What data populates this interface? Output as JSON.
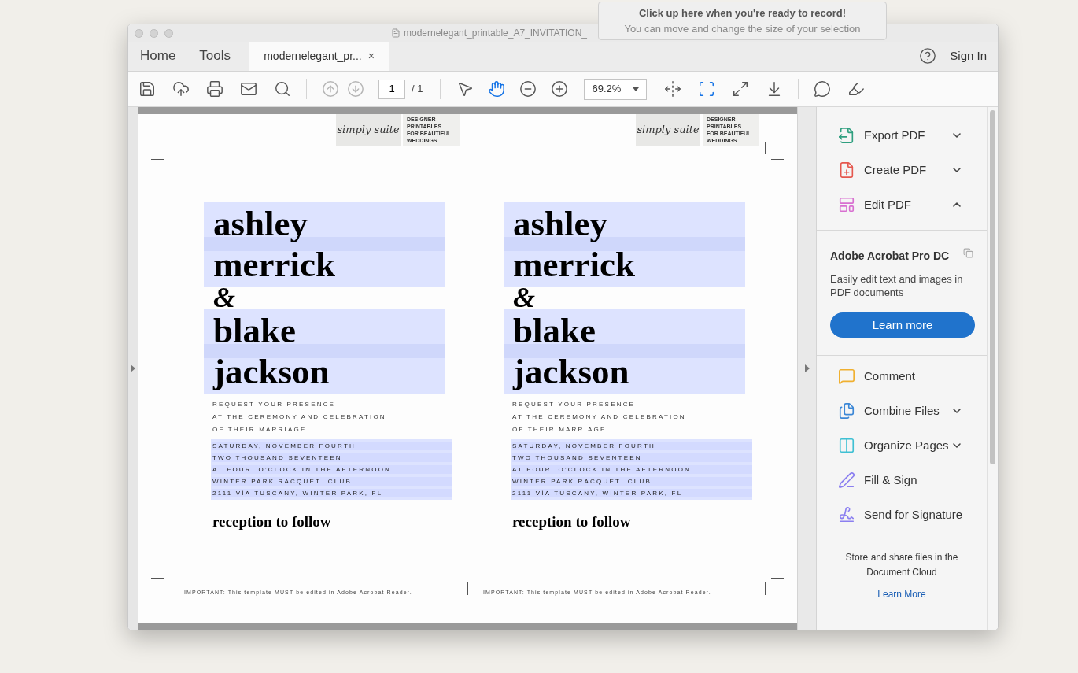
{
  "recorder_tip": {
    "title": "Click up here when you're ready to record!",
    "subtitle": "You can move and change the size of your selection"
  },
  "window": {
    "title": "modernelegant_printable_A7_INVITATION_"
  },
  "tabs": [
    {
      "label": "Home",
      "selected": false
    },
    {
      "label": "Tools",
      "selected": false
    },
    {
      "label": "modernelegant_pr...",
      "selected": true,
      "close": "×"
    }
  ],
  "sign_in": "Sign In",
  "toolbar": {
    "page_number": "1",
    "page_total": "/ 1",
    "zoom": "69.2%",
    "page_nav": [
      {
        "kind": "previous",
        "disabled": true
      },
      {
        "kind": "next",
        "disabled": true
      }
    ],
    "tools": [
      {
        "kind": "select",
        "selected": false
      },
      {
        "kind": "hand",
        "selected": true
      }
    ],
    "view_modes": [
      {
        "kind": "fit_page",
        "selected": false
      },
      {
        "kind": "fit_width",
        "selected": true
      },
      {
        "kind": "full_screen",
        "selected": false
      },
      {
        "kind": "read_mode",
        "selected": false
      }
    ]
  },
  "cards": [
    {
      "logo": "simply suite",
      "tagline": [
        "DESIGNER",
        "PRINTABLES",
        "FOR BEAUTIFUL",
        "WEDDINGS"
      ],
      "names_1": [
        "ashley",
        "merrick"
      ],
      "ampersand": "&",
      "names_2": [
        "blake",
        "jackson"
      ],
      "request": [
        "REQUEST YOUR PRESENCE",
        "AT THE CEREMONY AND CELEBRATION",
        "OF THEIR MARRIAGE"
      ],
      "details": [
        "SATURDAY, NOVEMBER FOURTH",
        "TWO THOUSAND SEVENTEEN",
        "AT FOUR  O'CLOCK IN THE AFTERNOON",
        "WINTER PARK RACQUET  CLUB",
        "2111 VÍA TUSCANY, WINTER PARK, FL"
      ],
      "reception": "reception to follow",
      "note": "IMPORTANT: This template MUST be edited in Adobe Acrobat Reader."
    },
    {
      "logo": "simply suite",
      "tagline": [
        "DESIGNER",
        "PRINTABLES",
        "FOR BEAUTIFUL",
        "WEDDINGS"
      ],
      "names_1": [
        "ashley",
        "merrick"
      ],
      "ampersand": "&",
      "names_2": [
        "blake",
        "jackson"
      ],
      "request": [
        "REQUEST YOUR PRESENCE",
        "AT THE CEREMONY AND CELEBRATION",
        "OF THEIR MARRIAGE"
      ],
      "details": [
        "SATURDAY, NOVEMBER FOURTH",
        "TWO THOUSAND SEVENTEEN",
        "AT FOUR  O'CLOCK IN THE AFTERNOON",
        "WINTER PARK RACQUET  CLUB",
        "2111 VÍA TUSCANY, WINTER PARK, FL"
      ],
      "reception": "reception to follow",
      "note": "IMPORTANT: This template MUST be edited in Adobe Acrobat Reader."
    }
  ],
  "sidebar": {
    "tools_top": [
      {
        "kind": "export",
        "label": "Export PDF",
        "expanded": false
      },
      {
        "kind": "create",
        "label": "Create PDF",
        "expanded": false
      },
      {
        "kind": "edit",
        "label": "Edit PDF",
        "expanded": true
      }
    ],
    "promo": {
      "title": "Adobe Acrobat Pro DC",
      "text": "Easily edit text and images in PDF documents",
      "button": "Learn more"
    },
    "tools_bottom": [
      {
        "kind": "comment",
        "label": "Comment"
      },
      {
        "kind": "combine",
        "label": "Combine Files",
        "expanded": false
      },
      {
        "kind": "organize",
        "label": "Organize Pages",
        "expanded": false
      },
      {
        "kind": "fill_sign",
        "label": "Fill & Sign"
      },
      {
        "kind": "send_signature",
        "label": "Send for Signature"
      }
    ],
    "cloud": {
      "text": "Store and share files in the Document Cloud",
      "link": "Learn More"
    }
  }
}
